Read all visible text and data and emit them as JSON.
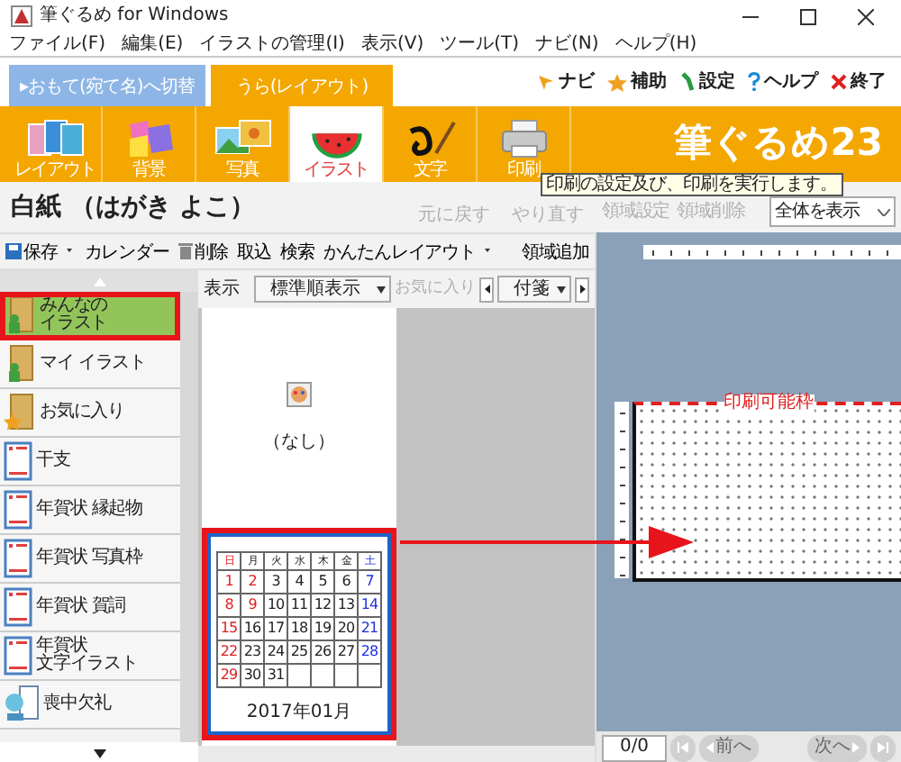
{
  "window": {
    "title": "筆ぐるめ for Windows"
  },
  "menu": [
    "ファイル(F)",
    "編集(E)",
    "イラストの管理(I)",
    "表示(V)",
    "ツール(T)",
    "ナビ(N)",
    "ヘルプ(H)"
  ],
  "side_tabs": [
    {
      "label": "▸おもて(宛て名)へ切替",
      "selected": false
    },
    {
      "label": "うら(レイアウト)",
      "selected": true
    }
  ],
  "top_links": [
    {
      "kind": "navi",
      "label": "ナビ"
    },
    {
      "kind": "assist",
      "label": "補助"
    },
    {
      "kind": "settings",
      "label": "設定"
    },
    {
      "kind": "help",
      "label": "ヘルプ"
    },
    {
      "kind": "exit",
      "label": "終了"
    }
  ],
  "modes": [
    {
      "kind": "layout",
      "label": "レイアウト",
      "selected": false
    },
    {
      "kind": "background",
      "label": "背景",
      "selected": false
    },
    {
      "kind": "photo",
      "label": "写真",
      "selected": false
    },
    {
      "kind": "illust",
      "label": "イラスト",
      "selected": true
    },
    {
      "kind": "text",
      "label": "文字",
      "selected": false
    },
    {
      "kind": "print",
      "label": "印刷",
      "selected": false
    }
  ],
  "logo": "筆ぐるめ23",
  "document": {
    "title": "白紙 （はがき よこ）",
    "undo": {
      "label": "元に戻す",
      "disabled": true
    },
    "redo": {
      "label": "やり直す",
      "disabled": true
    }
  },
  "toolbar": [
    {
      "kind": "save",
      "label": "保存",
      "dropdown": true
    },
    {
      "kind": "text",
      "label": "カレンダー",
      "dropdown": false
    },
    {
      "kind": "delete",
      "label": "削除",
      "dropdown": false
    },
    {
      "kind": "text",
      "label": "取込",
      "dropdown": false
    },
    {
      "kind": "text",
      "label": "検索",
      "dropdown": false
    },
    {
      "kind": "text",
      "label": "かんたんレイアウト",
      "dropdown": true
    },
    {
      "kind": "text",
      "label": "領域追加",
      "dropdown": false
    }
  ],
  "categories": [
    {
      "kind": "folder",
      "lines": [
        "みんなの",
        "イラスト"
      ],
      "selected": true
    },
    {
      "kind": "folder",
      "lines": [
        "マイ イラスト"
      ],
      "selected": false
    },
    {
      "kind": "favorite",
      "lines": [
        "お気に入り"
      ],
      "selected": false
    },
    {
      "kind": "card",
      "lines": [
        "干支"
      ],
      "selected": false
    },
    {
      "kind": "card",
      "lines": [
        "年賀状 縁起物"
      ],
      "selected": false
    },
    {
      "kind": "card",
      "lines": [
        "年賀状 写真枠"
      ],
      "selected": false
    },
    {
      "kind": "card",
      "lines": [
        "年賀状 賀詞"
      ],
      "selected": false
    },
    {
      "kind": "card",
      "lines": [
        "年賀状",
        "文字イラスト"
      ],
      "selected": false
    },
    {
      "kind": "mourning",
      "lines": [
        "喪中欠礼"
      ],
      "selected": false
    }
  ],
  "filter": {
    "label": "表示",
    "sort": "標準順表示",
    "favorites": {
      "label": "お気に入り",
      "disabled": true
    },
    "tag": "付箋"
  },
  "thumbnails": [
    {
      "kind": "none",
      "caption": "（なし）",
      "selected": false
    },
    {
      "kind": "calendar",
      "caption": "2017年01月",
      "selected": true,
      "weekdays": [
        {
          "label": "日",
          "kind": "holiday"
        },
        {
          "label": "月",
          "kind": "weekday"
        },
        {
          "label": "火",
          "kind": "weekday"
        },
        {
          "label": "水",
          "kind": "weekday"
        },
        {
          "label": "木",
          "kind": "weekday"
        },
        {
          "label": "金",
          "kind": "weekday"
        },
        {
          "label": "土",
          "kind": "saturday"
        }
      ],
      "days": [
        {
          "label": "1",
          "kind": "holiday"
        },
        {
          "label": "2",
          "kind": "holiday"
        },
        {
          "label": "3",
          "kind": "weekday"
        },
        {
          "label": "4",
          "kind": "weekday"
        },
        {
          "label": "5",
          "kind": "weekday"
        },
        {
          "label": "6",
          "kind": "weekday"
        },
        {
          "label": "7",
          "kind": "saturday"
        },
        {
          "label": "8",
          "kind": "holiday"
        },
        {
          "label": "9",
          "kind": "holiday"
        },
        {
          "label": "10",
          "kind": "weekday"
        },
        {
          "label": "11",
          "kind": "weekday"
        },
        {
          "label": "12",
          "kind": "weekday"
        },
        {
          "label": "13",
          "kind": "weekday"
        },
        {
          "label": "14",
          "kind": "saturday"
        },
        {
          "label": "15",
          "kind": "holiday"
        },
        {
          "label": "16",
          "kind": "weekday"
        },
        {
          "label": "17",
          "kind": "weekday"
        },
        {
          "label": "18",
          "kind": "weekday"
        },
        {
          "label": "19",
          "kind": "weekday"
        },
        {
          "label": "20",
          "kind": "weekday"
        },
        {
          "label": "21",
          "kind": "saturday"
        },
        {
          "label": "22",
          "kind": "holiday"
        },
        {
          "label": "23",
          "kind": "weekday"
        },
        {
          "label": "24",
          "kind": "weekday"
        },
        {
          "label": "25",
          "kind": "weekday"
        },
        {
          "label": "26",
          "kind": "weekday"
        },
        {
          "label": "27",
          "kind": "weekday"
        },
        {
          "label": "28",
          "kind": "saturday"
        },
        {
          "label": "29",
          "kind": "holiday"
        },
        {
          "label": "30",
          "kind": "weekday"
        },
        {
          "label": "31",
          "kind": "weekday"
        }
      ]
    }
  ],
  "preview": {
    "tooltip": "印刷の設定及び、印刷を実行します。",
    "tools": [
      {
        "label": "領域設定",
        "disabled": true
      },
      {
        "label": "領域削除",
        "disabled": true
      }
    ],
    "zoom": "全体を表示",
    "frame_label": "印刷可能枠",
    "page": "0/0",
    "prev": "前へ",
    "next": "次へ"
  }
}
